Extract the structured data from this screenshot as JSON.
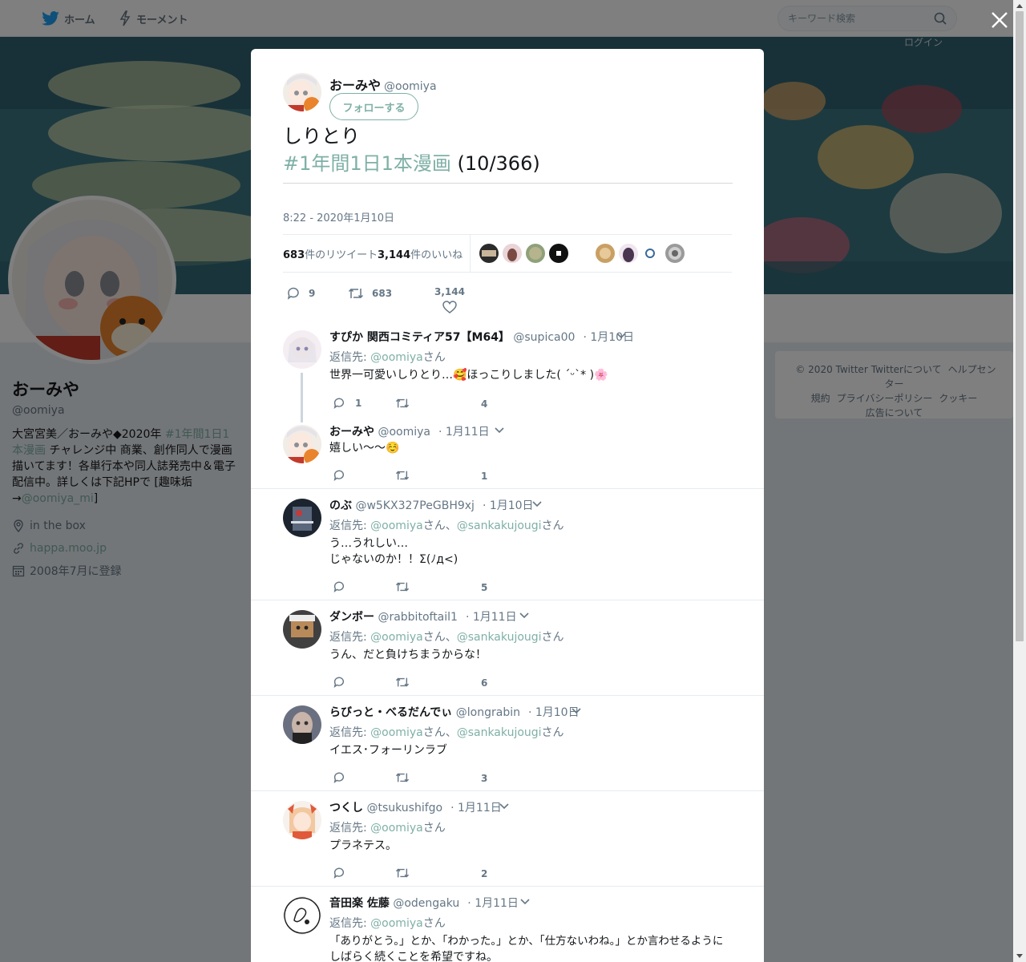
{
  "nav": {
    "home_label": "ホーム",
    "moments_label": "モーメント"
  },
  "search": {
    "placeholder": "キーワード検索"
  },
  "top_login": "ログイン",
  "profile": {
    "name": "おーみや",
    "handle": "@oomiya",
    "bio_prefix": "大宮宮美／おーみや◆2020年 ",
    "bio_hashtag": "#1年間1日1本漫画",
    "bio_middle": " チャレンジ中 商業、創作同人で漫画描いてます！各単行本や同人誌発売中＆電子配信中。詳しくは下記HPで [趣味垢→",
    "bio_mention": "@oomiya_mi",
    "bio_suffix": "]",
    "location": "in the box",
    "website": "happa.moo.jp",
    "joined": "2008年7月に登録"
  },
  "footer": {
    "copyright": "© 2020 Twitter",
    "about": "Twitterについて",
    "help": "ヘルプセンター",
    "terms": "規約",
    "privacy": "プライバシーポリシー",
    "cookies": "クッキー",
    "ads": "広告について"
  },
  "tweet": {
    "author_name": "おーみや",
    "author_handle": "@oomiya",
    "follow_label": "フォローする",
    "text_line1": "しりとり",
    "hashtag": "#1年間1日1本漫画",
    "text_suffix": " (10/366)",
    "timestamp": "8:22 - 2020年1月10日",
    "retweet_count": "683",
    "retweet_label": "件のリツイート",
    "like_count": "3,144",
    "like_label": "件のいいね",
    "actions": {
      "reply": "9",
      "retweet": "683",
      "like": "3,144"
    }
  },
  "replies": [
    {
      "name": "すぴか 関西コミティア57【M64】",
      "handle": "@supica00",
      "date": "· 1月10日",
      "reply_prefix": "返信先: ",
      "mentions": [
        "@oomiya"
      ],
      "san": "さん",
      "text": [
        "世界一可愛いしりとり…🥰ほっこりしました( ´ᵕ`* )🌸"
      ],
      "reply_count": "1",
      "retweet_count": "",
      "like_count": "4"
    },
    {
      "name": "おーみや",
      "handle": "@oomiya",
      "date": "· 1月11日",
      "text": [
        "嬉しい〜〜☺️"
      ],
      "reply_count": "",
      "retweet_count": "",
      "like_count": "1"
    },
    {
      "name": "のぶ",
      "handle": "@w5KX327PeGBH9xj",
      "date": "· 1月10日",
      "reply_prefix": "返信先: ",
      "mentions": [
        "@oomiya",
        "@sankakujougi"
      ],
      "san": "さん",
      "sep": "、",
      "text": [
        "う…うれしい…",
        "じゃないのか！！Σ(ﾉд<)"
      ],
      "like_count": "5"
    },
    {
      "name": "ダンボー",
      "handle": "@rabbitoftail1",
      "date": "· 1月11日",
      "reply_prefix": "返信先: ",
      "mentions": [
        "@oomiya",
        "@sankakujougi"
      ],
      "san": "さん",
      "sep": "、",
      "text": [
        "うん、だと負けちまうからな！"
      ],
      "like_count": "6"
    },
    {
      "name": "らびっと・べるだんでぃ",
      "handle": "@longrabin",
      "date": "· 1月10日",
      "reply_prefix": "返信先: ",
      "mentions": [
        "@oomiya",
        "@sankakujougi"
      ],
      "san": "さん",
      "sep": "、",
      "text": [
        "イエス･フォーリンラブ"
      ],
      "like_count": "3"
    },
    {
      "name": "つくし",
      "handle": "@tsukushifgo",
      "date": "· 1月11日",
      "reply_prefix": "返信先: ",
      "mentions": [
        "@oomiya"
      ],
      "san": "さん",
      "text": [
        "プラネテス。"
      ],
      "like_count": "2"
    },
    {
      "name": "音田楽 佐藤",
      "handle": "@odengaku",
      "date": "· 1月11日",
      "reply_prefix": "返信先: ",
      "mentions": [
        "@oomiya"
      ],
      "san": "さん",
      "text": [
        "「ありがとう。」とか、「わかった。」とか、「仕方ないわね。」とか言わせるように",
        "しばらく続くことを希望ですね。"
      ]
    }
  ],
  "colors": {
    "accent": "#7fb0a6",
    "muted": "#657786",
    "text": "#14171a"
  }
}
